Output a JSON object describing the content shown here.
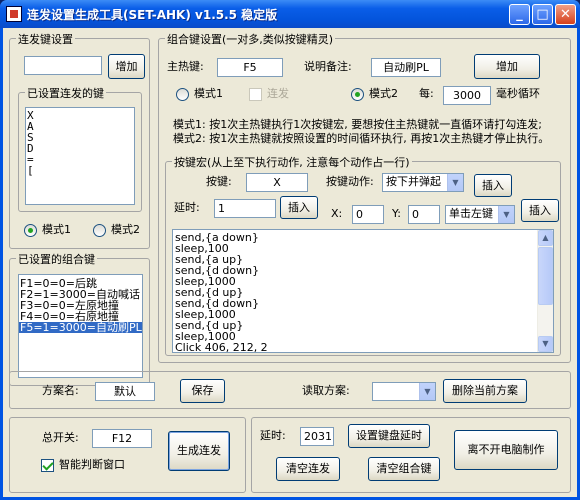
{
  "window": {
    "title": "连发设置生成工具(SET-AHK) v1.5.5 稳定版",
    "minimize": "_",
    "maximize": "□",
    "close": "✕"
  },
  "burst_keys": {
    "legend": "连发键设置",
    "input_value": "",
    "add_button": "增加",
    "list_legend": "已设置连发的键",
    "list": [
      "X",
      "A",
      "S",
      "D",
      "=",
      "["
    ],
    "mode1": "模式1",
    "mode2": "模式2",
    "mode1_selected": true
  },
  "combo_list": {
    "legend": "已设置的组合键",
    "items": [
      "F1=0=0=后跳",
      "F2=1=3000=自动喊话",
      "F3=0=0=左原地撞",
      "F4=0=0=右原地撞",
      "F5=1=3000=自动刷PL"
    ],
    "selected_index": 4
  },
  "combo_settings": {
    "legend": "组合键设置(一对多,类似按键精灵)",
    "main_hotkey_label": "主热键:",
    "main_hotkey_value": "F5",
    "note_label": "说明备注:",
    "note_value": "自动刷PL",
    "add_button": "增加",
    "mode1": "模式1",
    "burst_label": "连发",
    "mode2": "模式2",
    "mode2_selected": true,
    "every_label": "每:",
    "interval_value": "3000",
    "interval_unit": "毫秒循环",
    "desc1": "模式1: 按1次主热键执行1次按键宏, 要想按住主热键就一直循环请打勾连发;",
    "desc2": "模式2: 按1次主热键就按照设置的时间循环执行, 再按1次主热键才停止执行。"
  },
  "macro": {
    "legend": "按键宏(从上至下执行动作, 注意每个动作占一行)",
    "key_label": "按键:",
    "key_value": "X",
    "action_label": "按键动作:",
    "action_value": "按下并弹起",
    "insert1": "插入",
    "delay_label": "延时:",
    "delay_value": "1",
    "insert2": "插入",
    "x_label": "X:",
    "x_value": "0",
    "y_label": "Y:",
    "y_value": "0",
    "click_value": "单击左键",
    "insert3": "插入",
    "script": [
      "send,{a down}",
      "sleep,100",
      "send,{a up}",
      "send,{d down}",
      "sleep,1000",
      "send,{d up}",
      "send,{d down}",
      "sleep,1000",
      "send,{d up}",
      "sleep,1000",
      "Click 406, 212, 2"
    ]
  },
  "scheme": {
    "name_label": "方案名:",
    "name_value": "默认",
    "save_button": "保存",
    "read_label": "读取方案:",
    "read_value": "",
    "delete_button": "删除当前方案"
  },
  "bottom": {
    "master_label": "总开关:",
    "master_value": "F12",
    "generate_button": "生成连发",
    "smart_label": "智能判断窗口",
    "smart_checked": true,
    "delay_label": "延时:",
    "delay_value": "2031",
    "set_delay_button": "设置键盘延时",
    "clear_burst_button": "清空连发",
    "clear_combo_button": "清空组合键",
    "stay_button": "离不开电脑制作"
  },
  "colors": {
    "titlebar": "#0a5ee8",
    "selection": "#316ac5",
    "face": "#ece9d8"
  }
}
